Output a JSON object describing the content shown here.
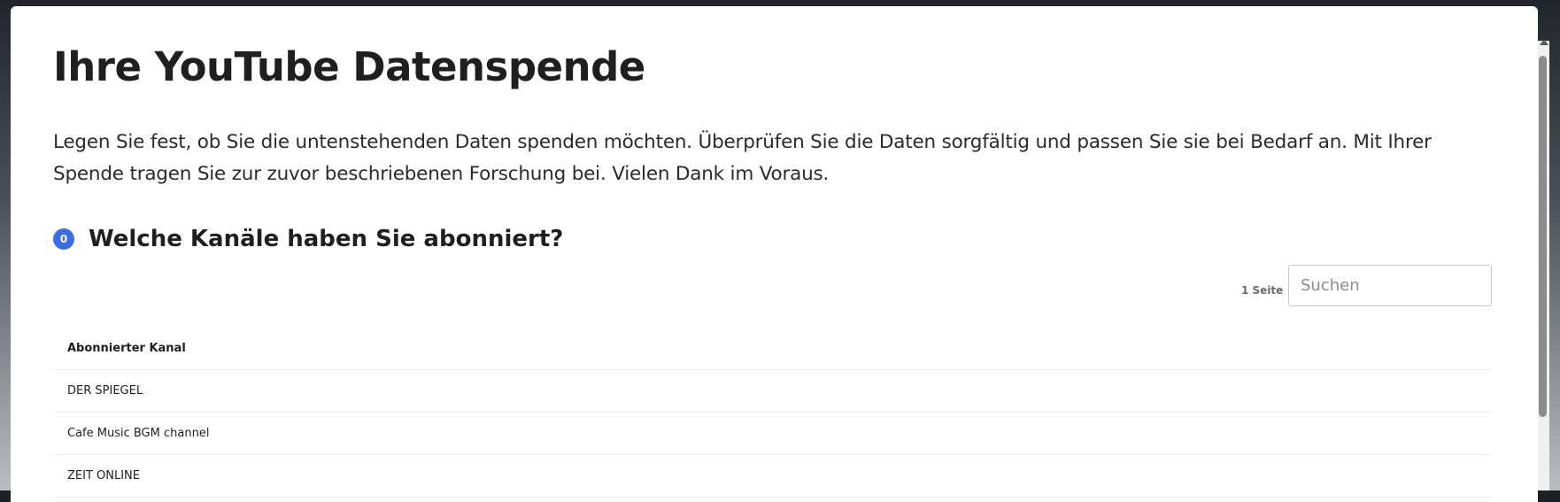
{
  "page": {
    "title": "Ihre YouTube Datenspende",
    "intro": "Legen Sie fest, ob Sie die untenstehenden Daten spenden möchten. Überprüfen Sie die Daten sorgfältig und passen Sie sie bei Bedarf an. Mit Ihrer Spende tragen Sie zur zuvor beschriebenen Forschung bei. Vielen Dank im Voraus."
  },
  "section": {
    "badge_count": "0",
    "title": "Welche Kanäle haben Sie abonniert?",
    "accent_color": "#3d6de6"
  },
  "table_controls": {
    "page_info": "1 Seite",
    "search_placeholder": "Suchen",
    "search_value": ""
  },
  "table": {
    "columns": [
      "Abonnierter Kanal"
    ],
    "rows": [
      [
        "DER SPIEGEL"
      ],
      [
        "Cafe Music BGM channel"
      ],
      [
        "ZEIT ONLINE"
      ]
    ]
  }
}
